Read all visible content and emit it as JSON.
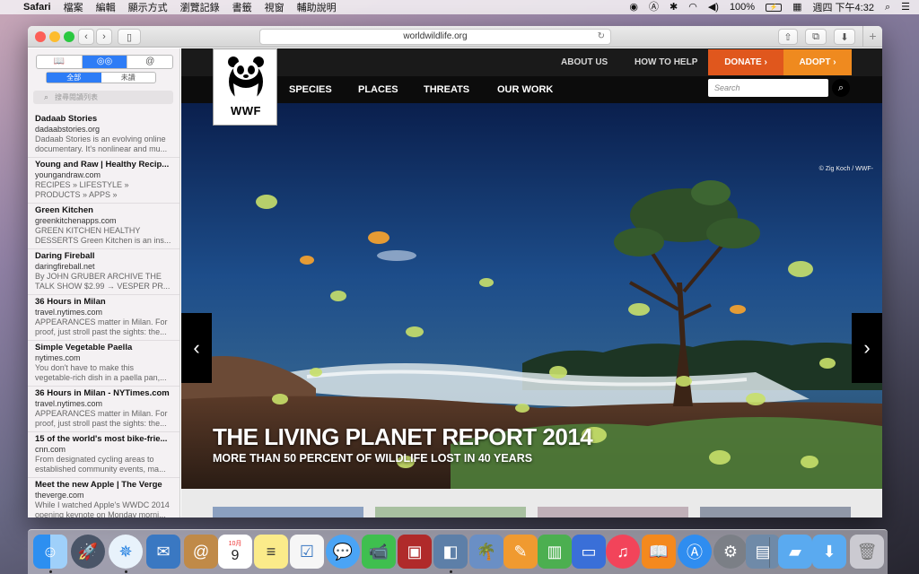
{
  "menubar": {
    "app": "Safari",
    "menus": [
      "檔案",
      "編輯",
      "顯示方式",
      "瀏覽記錄",
      "書籤",
      "視窗",
      "輔助說明"
    ],
    "battery": "100%",
    "clock": "週四 下午4:32"
  },
  "browser": {
    "url": "worldwildlife.org"
  },
  "sidebar": {
    "tab_icons": [
      "book-icon",
      "glasses-icon",
      "at-icon"
    ],
    "filters": [
      "全部",
      "未讀"
    ],
    "search_placeholder": "搜尋閱讀列表",
    "items": [
      {
        "title": "Dadaab Stories",
        "domain": "dadaabstories.org",
        "excerpt": "Dadaab Stories is an evolving online documentary. It's nonlinear and mu..."
      },
      {
        "title": "Young and Raw | Healthy Recip...",
        "domain": "youngandraw.com",
        "excerpt": "RECIPES » LIFESTYLE » PRODUCTS » APPS » AMBASSADORS WRITE..."
      },
      {
        "title": "Green Kitchen",
        "domain": "greenkitchenapps.com",
        "excerpt": "GREEN KITCHEN HEALTHY DESSERTS Green Kitchen is an ins..."
      },
      {
        "title": "Daring Fireball",
        "domain": "daringfireball.net",
        "excerpt": "By JOHN GRUBER ARCHIVE THE TALK SHOW $2.99 → VESPER PR..."
      },
      {
        "title": "36 Hours in Milan",
        "domain": "travel.nytimes.com",
        "excerpt": "APPEARANCES matter in Milan. For proof, just stroll past the sights: the..."
      },
      {
        "title": "Simple Vegetable Paella",
        "domain": "nytimes.com",
        "excerpt": "You don't have to make this vegetable-rich dish in a paella pan,..."
      },
      {
        "title": "36 Hours in Milan - NYTimes.com",
        "domain": "travel.nytimes.com",
        "excerpt": "APPEARANCES matter in Milan. For proof, just stroll past the sights: the..."
      },
      {
        "title": "15 of the world's most bike-frie...",
        "domain": "cnn.com",
        "excerpt": "From designated cycling areas to established community events, ma..."
      },
      {
        "title": "Meet the new Apple | The Verge",
        "domain": "theverge.com",
        "excerpt": "While I watched Apple's WWDC 2014 opening keynote on Monday morni..."
      }
    ]
  },
  "site": {
    "top_links": [
      "ABOUT US",
      "HOW TO HELP"
    ],
    "donate": "DONATE ›",
    "adopt": "ADOPT ›",
    "nav": [
      "SPECIES",
      "PLACES",
      "THREATS",
      "OUR WORK"
    ],
    "search_placeholder": "Search",
    "logo_text": "WWF",
    "hero": {
      "credit": "© Zig Koch / WWF-",
      "headline": "THE LIVING PLANET REPORT 2014",
      "subheadline": "MORE THAN 50 PERCENT OF WILDLIFE LOST IN 40 YEARS"
    }
  },
  "dock": {
    "apps": [
      "finder-icon",
      "launchpad-icon",
      "safari-icon",
      "mail-icon",
      "contacts-icon",
      "calendar-icon",
      "notes-icon",
      "reminders-icon",
      "messages-icon",
      "facetime-icon",
      "photo-booth-icon",
      "preview-icon",
      "iphoto-icon",
      "pages-icon",
      "numbers-icon",
      "keynote-icon",
      "itunes-icon",
      "ibooks-icon",
      "app-store-icon",
      "system-preferences-icon",
      "image-capture-icon"
    ],
    "calendar_month": "10月",
    "calendar_day": "9"
  }
}
